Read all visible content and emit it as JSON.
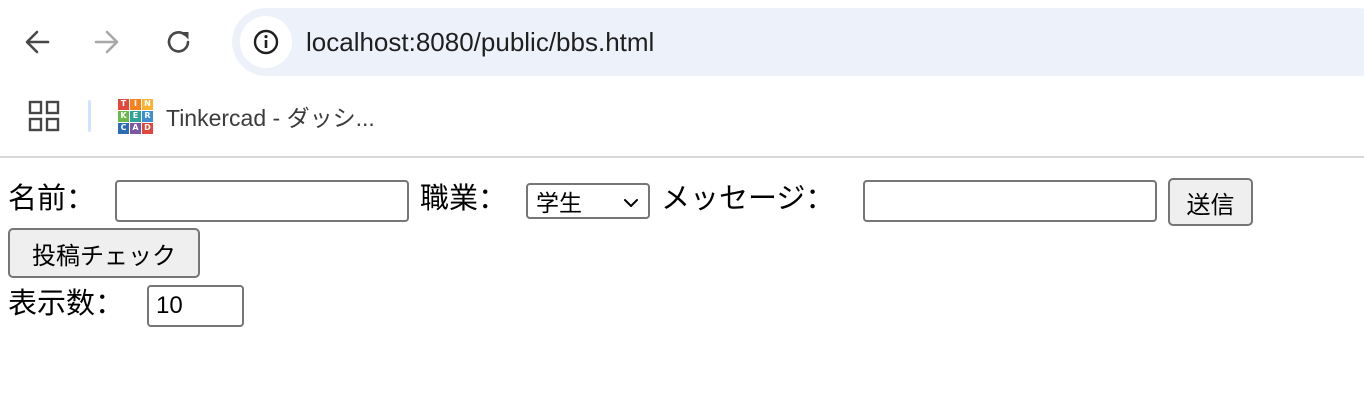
{
  "browser": {
    "url": "localhost:8080/public/bbs.html",
    "nav": {
      "back_icon": "arrow-left-icon",
      "forward_icon": "arrow-right-icon",
      "reload_icon": "reload-icon",
      "site_info_icon": "info-icon"
    },
    "bookmarks_bar": {
      "apps_icon": "apps-grid-icon",
      "items": [
        {
          "label": "Tinkercad - ダッシ...",
          "icon": "tinkercad-logo",
          "logo_letters": [
            "T",
            "I",
            "N",
            "K",
            "E",
            "R",
            "C",
            "A",
            "D"
          ],
          "logo_colors": [
            "#e2473b",
            "#f5821f",
            "#f9b232",
            "#6ab84e",
            "#2fa39a",
            "#3e8ed0",
            "#2c6db3",
            "#7d56a1",
            "#e2473b"
          ]
        }
      ]
    }
  },
  "form": {
    "name_label": "名前：",
    "name_value": "",
    "job_label": "職業：",
    "job_selected": "学生",
    "message_label": "メッセージ：",
    "message_value": "",
    "send_button": "送信",
    "check_button": "投稿チェック",
    "count_label": "表示数：",
    "count_value": "10"
  }
}
